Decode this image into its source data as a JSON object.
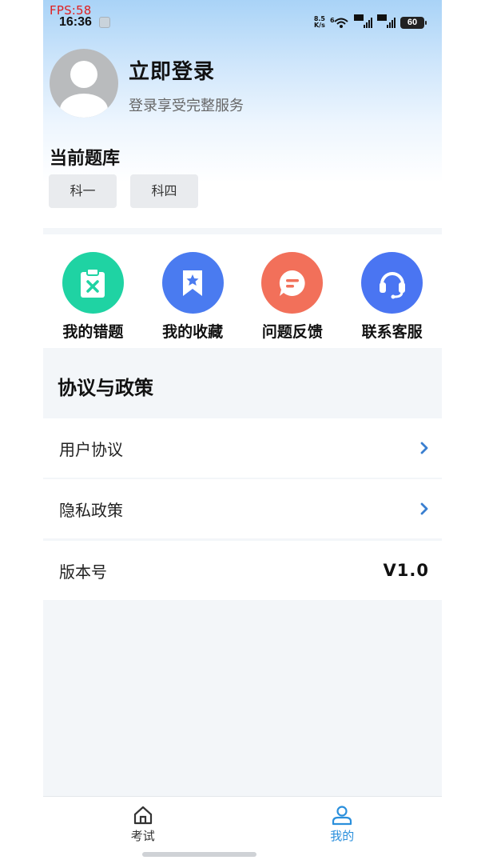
{
  "status_bar": {
    "fps": "FPS:58",
    "time": "16:36",
    "net_speed_value": "8.5",
    "net_speed_unit": "K/s",
    "wifi_tag": "6",
    "sim1_tag": "5A",
    "sim2_tag": "5A",
    "battery": "60"
  },
  "profile": {
    "title": "立即登录",
    "subtitle": "登录享受完整服务"
  },
  "question_bank": {
    "title": "当前题库",
    "options": [
      "科一",
      "科四"
    ]
  },
  "features": [
    {
      "label": "我的错题",
      "icon": "clipboard-x-icon",
      "color": "#1fd3a3"
    },
    {
      "label": "我的收藏",
      "icon": "bookmark-star-icon",
      "color": "#4a7bf0"
    },
    {
      "label": "问题反馈",
      "icon": "chat-bubble-icon",
      "color": "#f2705a"
    },
    {
      "label": "联系客服",
      "icon": "headset-icon",
      "color": "#4a75f2"
    }
  ],
  "policy": {
    "title": "协议与政策",
    "items": [
      {
        "label": "用户协议"
      },
      {
        "label": "隐私政策"
      }
    ],
    "version_label": "版本号",
    "version_value": "V1.0"
  },
  "tabbar": {
    "tabs": [
      {
        "label": "考试",
        "icon": "home-icon",
        "active": false
      },
      {
        "label": "我的",
        "icon": "user-icon",
        "active": true
      }
    ],
    "active_color": "#2a8fdc",
    "inactive_color": "#333333"
  }
}
